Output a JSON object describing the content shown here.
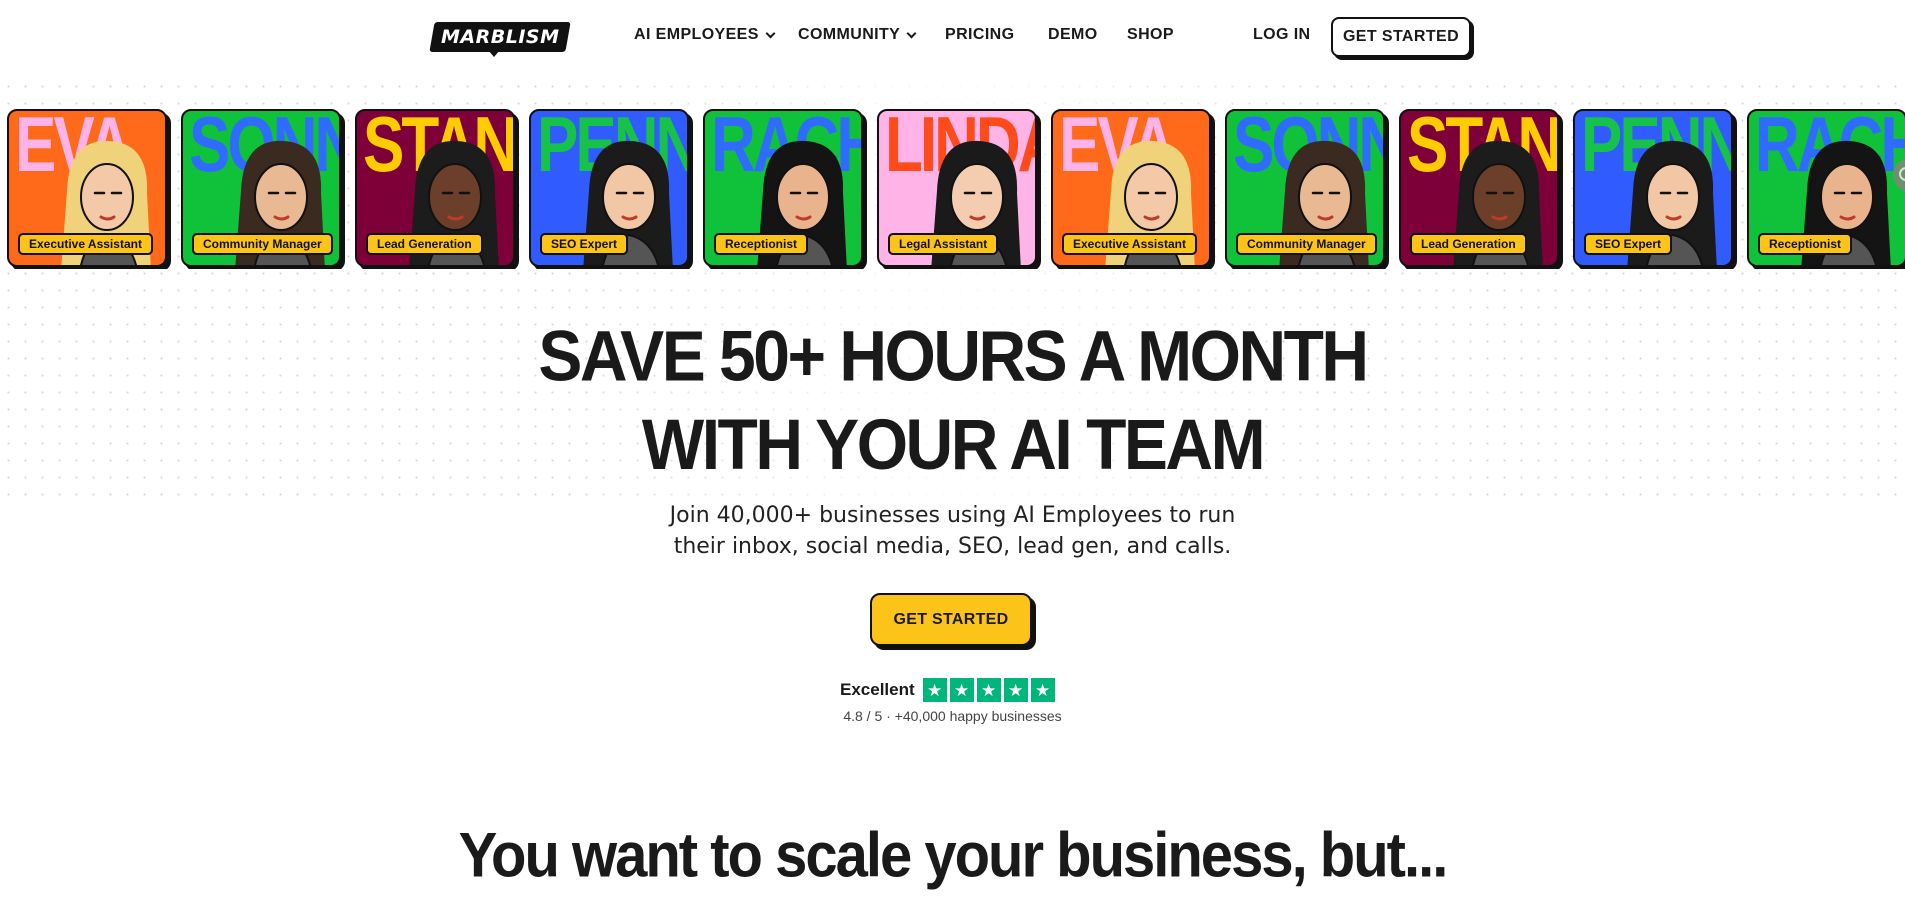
{
  "nav": {
    "logo": "MARBLISM",
    "items": [
      {
        "label": "AI EMPLOYEES",
        "dropdown": true
      },
      {
        "label": "COMMUNITY",
        "dropdown": true
      },
      {
        "label": "PRICING",
        "dropdown": false
      },
      {
        "label": "DEMO",
        "dropdown": false
      },
      {
        "label": "SHOP",
        "dropdown": false
      }
    ],
    "login": "LOG IN",
    "cta": "GET STARTED"
  },
  "cards": [
    {
      "name": "EVA",
      "role": "Executive Assistant",
      "bg": "#ff6a1a",
      "name_color": "#ffb3e6"
    },
    {
      "name": "SONNY",
      "role": "Community Manager",
      "bg": "#10c23a",
      "name_color": "#2f6bff"
    },
    {
      "name": "STAN",
      "role": "Lead Generation",
      "bg": "#7d0038",
      "name_color": "#ffcc00"
    },
    {
      "name": "PENNY",
      "role": "SEO Expert",
      "bg": "#2f5bff",
      "name_color": "#16c24a"
    },
    {
      "name": "RACHEL",
      "role": "Receptionist",
      "bg": "#10c23a",
      "name_color": "#2f6bff"
    },
    {
      "name": "LINDA",
      "role": "Legal Assistant",
      "bg": "#ffb3e6",
      "name_color": "#ff4a1a"
    },
    {
      "name": "EVA",
      "role": "Executive Assistant",
      "bg": "#ff6a1a",
      "name_color": "#ffb3e6"
    },
    {
      "name": "SONNY",
      "role": "Community Manager",
      "bg": "#10c23a",
      "name_color": "#2f6bff"
    },
    {
      "name": "STAN",
      "role": "Lead Generation",
      "bg": "#7d0038",
      "name_color": "#ffcc00"
    },
    {
      "name": "PENNY",
      "role": "SEO Expert",
      "bg": "#2f5bff",
      "name_color": "#16c24a"
    },
    {
      "name": "RACHEL",
      "role": "Receptionist",
      "bg": "#10c23a",
      "name_color": "#2f6bff"
    }
  ],
  "hero": {
    "title_line1": "SAVE 50+ HOURS A MONTH",
    "title_line2": "WITH YOUR AI TEAM",
    "subtitle_line1": "Join 40,000+ businesses using AI Employees to run",
    "subtitle_line2": "their inbox, social media, SEO, lead gen, and calls.",
    "cta": "GET STARTED"
  },
  "rating": {
    "label": "Excellent",
    "stars": 5,
    "summary": "4.8 / 5 · +40,000 happy businesses",
    "star_color": "#00b67a"
  },
  "section": {
    "title": "You want to scale your business, but..."
  },
  "colors": {
    "accent": "#fcc419",
    "ink": "#111111"
  }
}
